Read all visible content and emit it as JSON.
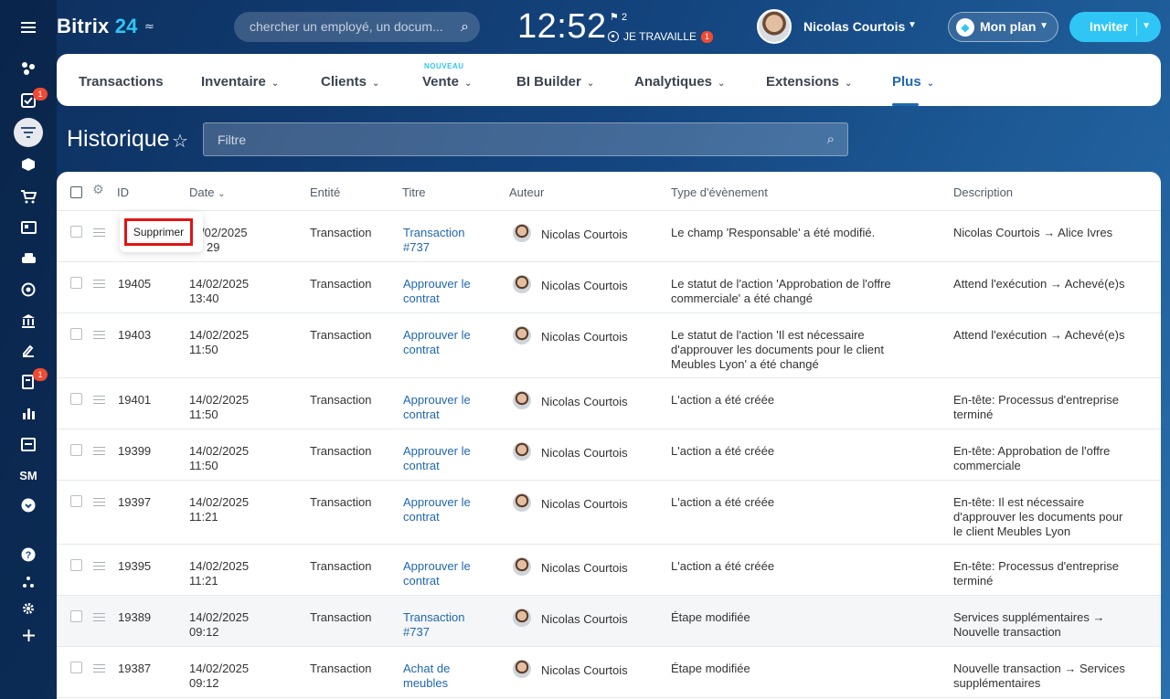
{
  "app": {
    "logo_text": "Bitrix",
    "logo_num": "24",
    "search_placeholder": "chercher un employé, un docum...",
    "time": "12:52",
    "flag_count": "2",
    "work_status": "JE TRAVAILLE",
    "work_badge": "1",
    "user_name": "Nicolas Courtois",
    "plan_label": "Mon plan",
    "invite_label": "Inviter"
  },
  "sidebar": {
    "badges": [
      "1",
      "1"
    ],
    "sm_label": "SM"
  },
  "menu": {
    "items": [
      {
        "label": "Transactions"
      },
      {
        "label": "Inventaire"
      },
      {
        "label": "Clients"
      },
      {
        "label": "Vente"
      },
      {
        "label": "BI Builder"
      },
      {
        "label": "Analytiques"
      },
      {
        "label": "Extensions"
      },
      {
        "label": "Plus"
      }
    ],
    "new_tag": "NOUVEAU"
  },
  "page": {
    "title": "Historique",
    "filter_placeholder": "Filtre"
  },
  "table": {
    "headers": {
      "id": "ID",
      "date": "Date",
      "entity": "Entité",
      "title": "Titre",
      "author": "Auteur",
      "event_type": "Type d'évènement",
      "description": "Description"
    },
    "rows": [
      {
        "id": "",
        "date1": "/02/2025",
        "date2": "29",
        "entity": "Transaction",
        "title1": "Transaction",
        "title2": "#737",
        "author": "Nicolas Courtois",
        "event1": "Le champ 'Responsable' a été modifié.",
        "event2": "",
        "event3": "",
        "desc1": "Nicolas Courtois → Alice Ivres",
        "desc2": "",
        "desc3": ""
      },
      {
        "id": "19405",
        "date1": "14/02/2025",
        "date2": "13:40",
        "entity": "Transaction",
        "title1": "Approuver le",
        "title2": "contrat",
        "author": "Nicolas Courtois",
        "event1": "Le statut de l'action 'Approbation de l'offre",
        "event2": "commerciale' a été changé",
        "event3": "",
        "desc1": "Attend l'exécution → Achevé(e)s",
        "desc2": "",
        "desc3": ""
      },
      {
        "id": "19403",
        "date1": "14/02/2025",
        "date2": "11:50",
        "entity": "Transaction",
        "title1": "Approuver le",
        "title2": "contrat",
        "author": "Nicolas Courtois",
        "event1": "Le statut de l'action 'Il est nécessaire",
        "event2": "d'approuver les documents pour le client",
        "event3": "Meubles Lyon' a été changé",
        "desc1": "Attend l'exécution → Achevé(e)s",
        "desc2": "",
        "desc3": ""
      },
      {
        "id": "19401",
        "date1": "14/02/2025",
        "date2": "11:50",
        "entity": "Transaction",
        "title1": "Approuver le",
        "title2": "contrat",
        "author": "Nicolas Courtois",
        "event1": "L'action a été créée",
        "event2": "",
        "event3": "",
        "desc1": "En-tête: Processus d'entreprise",
        "desc2": "terminé",
        "desc3": ""
      },
      {
        "id": "19399",
        "date1": "14/02/2025",
        "date2": "11:50",
        "entity": "Transaction",
        "title1": "Approuver le",
        "title2": "contrat",
        "author": "Nicolas Courtois",
        "event1": "L'action a été créée",
        "event2": "",
        "event3": "",
        "desc1": "En-tête: Approbation de l'offre",
        "desc2": "commerciale",
        "desc3": ""
      },
      {
        "id": "19397",
        "date1": "14/02/2025",
        "date2": "11:21",
        "entity": "Transaction",
        "title1": "Approuver le",
        "title2": "contrat",
        "author": "Nicolas Courtois",
        "event1": "L'action a été créée",
        "event2": "",
        "event3": "",
        "desc1": "En-tête: Il est nécessaire",
        "desc2": "d'approuver les documents pour",
        "desc3": "le client Meubles Lyon"
      },
      {
        "id": "19395",
        "date1": "14/02/2025",
        "date2": "11:21",
        "entity": "Transaction",
        "title1": "Approuver le",
        "title2": "contrat",
        "author": "Nicolas Courtois",
        "event1": "L'action a été créée",
        "event2": "",
        "event3": "",
        "desc1": "En-tête: Processus d'entreprise",
        "desc2": "terminé",
        "desc3": ""
      },
      {
        "id": "19389",
        "date1": "14/02/2025",
        "date2": "09:12",
        "entity": "Transaction",
        "title1": "Transaction",
        "title2": "#737",
        "author": "Nicolas Courtois",
        "event1": "Étape modifiée",
        "event2": "",
        "event3": "",
        "desc1": "Services supplémentaires →",
        "desc2": "Nouvelle transaction",
        "desc3": ""
      },
      {
        "id": "19387",
        "date1": "14/02/2025",
        "date2": "09:12",
        "entity": "Transaction",
        "title1": "Achat de",
        "title2": "meubles",
        "author": "Nicolas Courtois",
        "event1": "Étape modifiée",
        "event2": "",
        "event3": "",
        "desc1": "Nouvelle transaction → Services",
        "desc2": "supplémentaires",
        "desc3": ""
      }
    ]
  },
  "context_menu": {
    "delete_label": "Supprimer"
  }
}
